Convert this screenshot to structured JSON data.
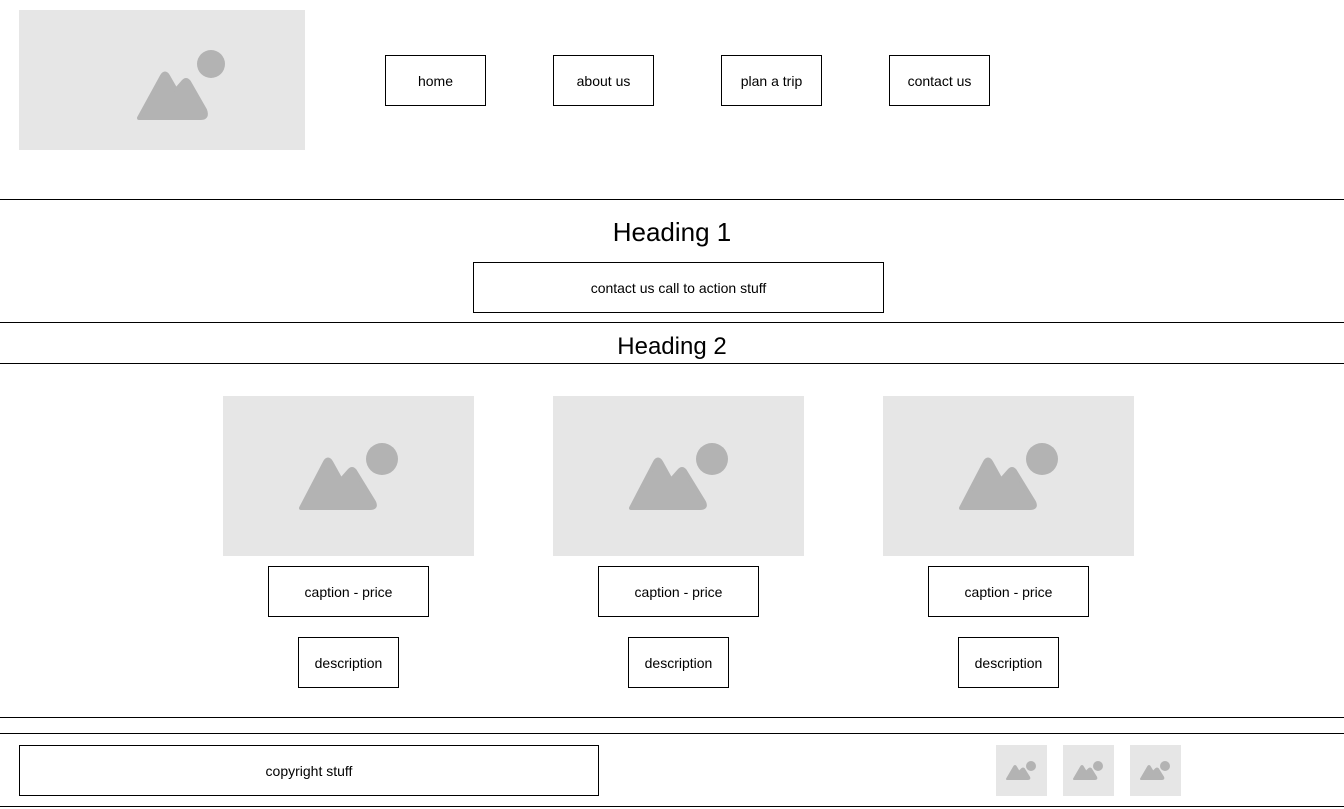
{
  "nav": {
    "items": [
      {
        "label": "home"
      },
      {
        "label": "about us"
      },
      {
        "label": "plan a trip"
      },
      {
        "label": "contact us"
      }
    ]
  },
  "hero": {
    "heading": "Heading 1",
    "cta_label": "contact us call to action stuff"
  },
  "products": {
    "heading": "Heading 2",
    "cards": [
      {
        "caption": "caption - price",
        "description": "description"
      },
      {
        "caption": "caption - price",
        "description": "description"
      },
      {
        "caption": "caption - price",
        "description": "description"
      }
    ]
  },
  "footer": {
    "copyright": "copyright stuff"
  },
  "icons": {
    "placeholder": "image-placeholder-icon"
  },
  "colors": {
    "placeholder_bg": "#e6e6e6",
    "placeholder_fg": "#b3b3b3",
    "border": "#000000"
  }
}
